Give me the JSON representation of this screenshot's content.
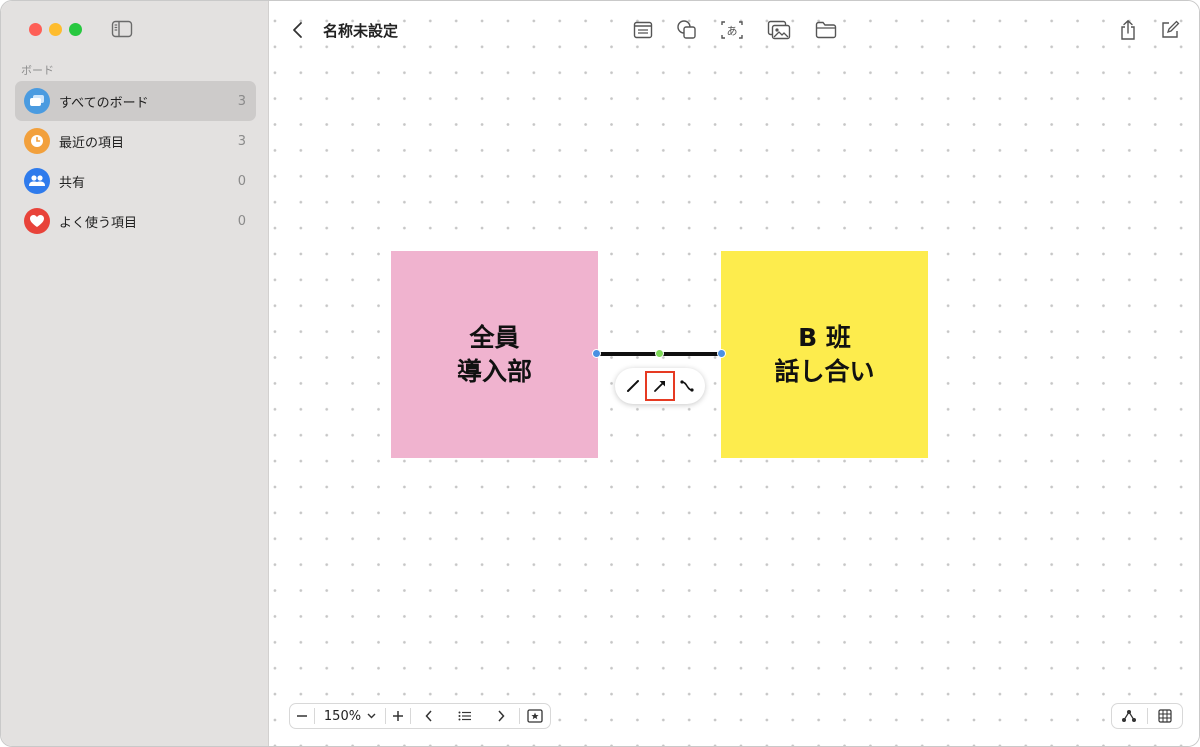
{
  "sidebar": {
    "section_label": "ボード",
    "items": [
      {
        "label": "すべてのボード",
        "count": "3",
        "icon": "boards-icon",
        "color": "#4a9be0"
      },
      {
        "label": "最近の項目",
        "count": "3",
        "icon": "clock-icon",
        "color": "#f2a03c"
      },
      {
        "label": "共有",
        "count": "0",
        "icon": "people-icon",
        "color": "#2f7bec"
      },
      {
        "label": "よく使う項目",
        "count": "0",
        "icon": "heart-icon",
        "color": "#e8433a"
      }
    ]
  },
  "header": {
    "title": "名称未設定"
  },
  "board": {
    "sticky_left": {
      "line1": "全員",
      "line2": "導入部",
      "color": "#f0b3cf"
    },
    "sticky_right": {
      "line1": "B 班",
      "line2": "話し合い",
      "color": "#fdec4d"
    }
  },
  "zoom": {
    "level": "150%"
  }
}
